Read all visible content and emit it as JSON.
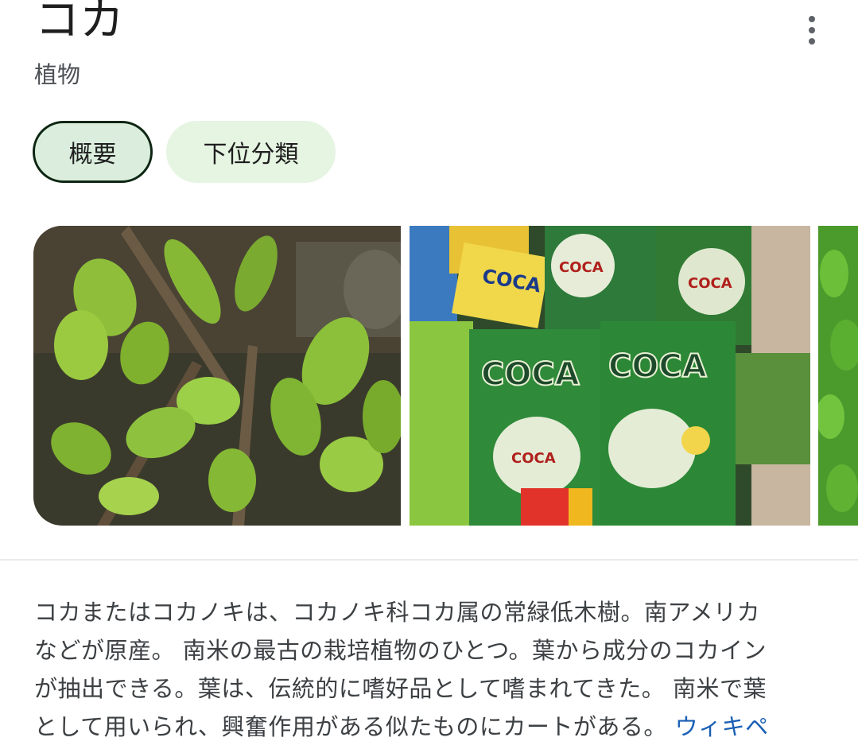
{
  "header": {
    "title": "コカ",
    "subtitle": "植物",
    "more_icon": "more-vert-icon"
  },
  "tabs": [
    {
      "label": "概要",
      "active": true
    },
    {
      "label": "下位分類",
      "active": false
    }
  ],
  "images": [
    {
      "icon": "coca-plant-photo"
    },
    {
      "icon": "coca-products-photo",
      "labels": [
        "COCA",
        "COCA",
        "COCA",
        "COCA",
        "COCA",
        "COCA"
      ]
    },
    {
      "icon": "green-foliage-photo"
    }
  ],
  "description": {
    "lines": [
      "コカまたはコカノキは、コカノキ科コカ属の常緑低木樹。南アメリカ",
      "などが原産。 南米の最古の栽培植物のひとつ。葉から成分のコカイン",
      "が抽出できる。葉は、伝統的に嗜好品として嗜まれてきた。 南米で葉",
      "として用いられ、興奮作用がある似たものにカートがある。"
    ],
    "link_label": "ウィキペ"
  },
  "colors": {
    "chip_bg": "#e6f4e2",
    "chip_active_border": "#0d2612",
    "link": "#1a5fb4",
    "body_text": "#3c4043"
  }
}
